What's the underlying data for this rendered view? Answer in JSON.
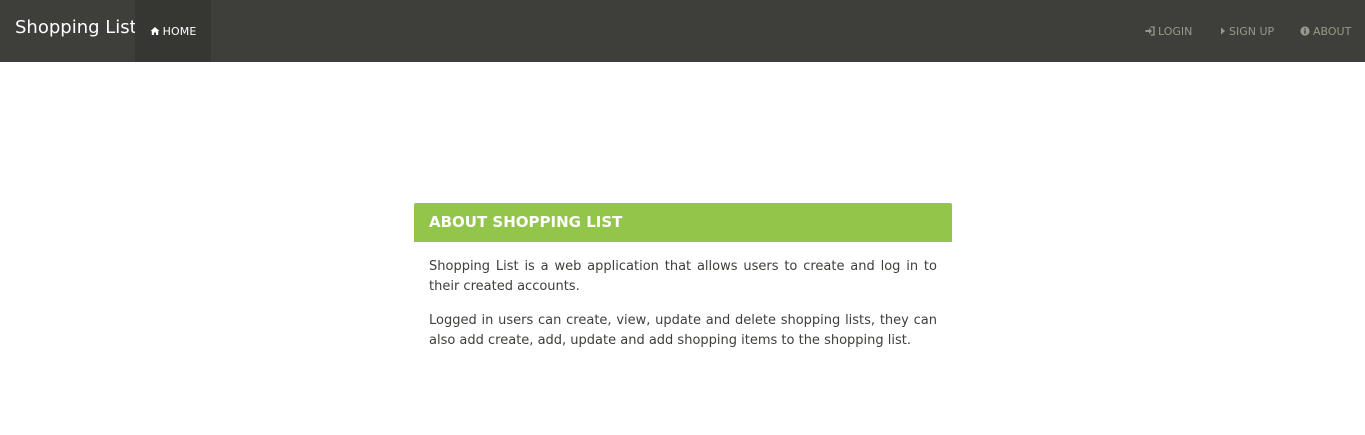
{
  "navbar": {
    "brand": "Shopping List",
    "home_label": "HOME",
    "login_label": "LOGIN",
    "signup_label": "SIGN UP",
    "about_label": "ABOUT",
    "background_color": "#3e3f3a",
    "active_background_color": "#363732",
    "inactive_text_color": "#98978b"
  },
  "panel": {
    "heading": "ABOUT SHOPPING LIST",
    "heading_color": "#93c54b",
    "paragraphs": [
      "Shopping List is a web application that allows users to create and log in to their created accounts.",
      "Logged in users can create, view, update and delete shopping lists, they can also add create, add, update and add shopping items to the shopping list."
    ]
  },
  "icons": {
    "home": "home-icon",
    "login": "sign-in-icon",
    "signup": "caret-right-icon",
    "about": "info-circle-icon"
  }
}
